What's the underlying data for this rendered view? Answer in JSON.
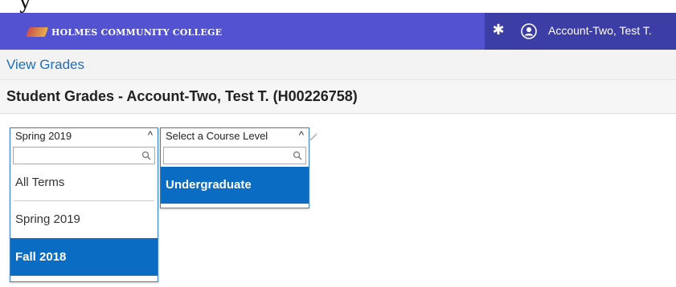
{
  "page_caption": "y",
  "header": {
    "logo_text": "HOLMES COMMUNITY COLLEGE",
    "user_name": "Account-Two, Test T.",
    "icons": {
      "settings": "gear-icon",
      "user": "user-circle-icon"
    },
    "colors": {
      "bar": "#5353d1",
      "right_block": "#3d3da6"
    }
  },
  "breadcrumb": {
    "label": "View Grades",
    "color": "#1f6fb5"
  },
  "page_title": "Student Grades - Account-Two, Test T. (H00226758)",
  "term_select": {
    "selected": "Spring 2019",
    "search_value": "",
    "options": [
      {
        "label": "All Terms",
        "highlighted": false
      },
      {
        "label": "Spring 2019",
        "highlighted": false
      },
      {
        "label": "Fall 2018",
        "highlighted": true
      }
    ]
  },
  "level_select": {
    "placeholder": "Select a Course Level",
    "search_value": "",
    "options": [
      {
        "label": "Undergraduate",
        "highlighted": true
      }
    ]
  },
  "accent_color": "#0a6cc2"
}
